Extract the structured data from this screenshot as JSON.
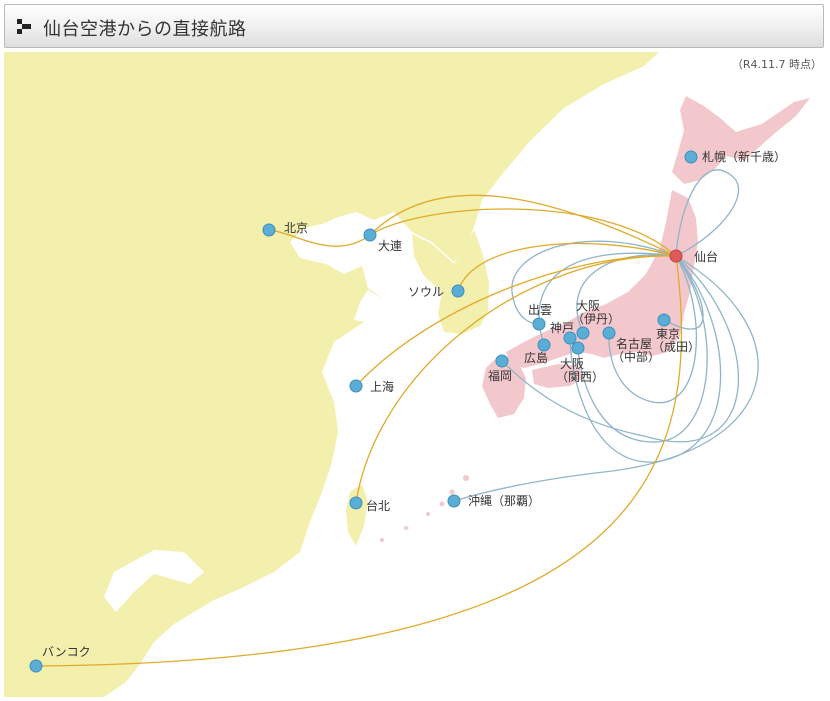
{
  "header": {
    "title": "仙台空港からの直接航路"
  },
  "note": "（R4.11.7 時点）",
  "colors": {
    "sea": "#ffffff",
    "foreign_land": "#f3efad",
    "japan_land": "#f2c8cd",
    "domestic_route": "#8fb5c8",
    "international_route": "#e0aa2a",
    "airport_dot": "#5aaed6",
    "hub_dot": "#e05a5a",
    "label": "#333333"
  },
  "hub": {
    "label": "仙台"
  },
  "airports": [
    {
      "id": "sapporo",
      "label": "札幌（新千歳）",
      "type": "domestic"
    },
    {
      "id": "tokyo",
      "label": "東京\n（成田）",
      "type": "domestic"
    },
    {
      "id": "nagoya",
      "label": "名古屋\n（中部）",
      "type": "domestic"
    },
    {
      "id": "osaka-itami",
      "label": "大阪\n（伊丹）",
      "type": "domestic"
    },
    {
      "id": "osaka-kansai",
      "label": "大阪\n（関西）",
      "type": "domestic"
    },
    {
      "id": "kobe",
      "label": "神戸",
      "type": "domestic"
    },
    {
      "id": "izumo",
      "label": "出雲",
      "type": "domestic"
    },
    {
      "id": "hiroshima",
      "label": "広島",
      "type": "domestic"
    },
    {
      "id": "fukuoka",
      "label": "福岡",
      "type": "domestic"
    },
    {
      "id": "okinawa",
      "label": "沖縄（那覇）",
      "type": "domestic"
    },
    {
      "id": "beijing",
      "label": "北京",
      "type": "international"
    },
    {
      "id": "dalian",
      "label": "大連",
      "type": "international"
    },
    {
      "id": "seoul",
      "label": "ソウル",
      "type": "international"
    },
    {
      "id": "shanghai",
      "label": "上海",
      "type": "international"
    },
    {
      "id": "taipei",
      "label": "台北",
      "type": "international"
    },
    {
      "id": "bangkok",
      "label": "バンコク",
      "type": "international"
    }
  ]
}
